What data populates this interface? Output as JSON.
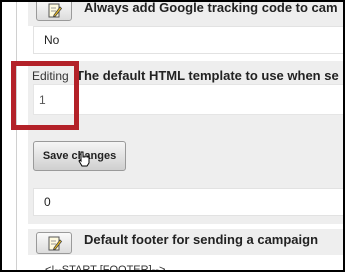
{
  "settings": {
    "google_tracking": {
      "label": "Always add Google tracking code to cam",
      "value": "No"
    },
    "html_template": {
      "editing_label": "Editing",
      "label": "The default HTML template to use when se",
      "value": "1",
      "save_label": "Save changes",
      "display_value": "0"
    },
    "default_footer": {
      "label": "Default footer for sending a campaign",
      "value_preview": "<!--START [FOOTER]-->"
    }
  },
  "colors": {
    "highlight": "#b32128",
    "panel_bg": "#eeeeee"
  },
  "icons": {
    "edit": "edit-pencil-icon",
    "cursor": "hand-cursor-icon"
  }
}
